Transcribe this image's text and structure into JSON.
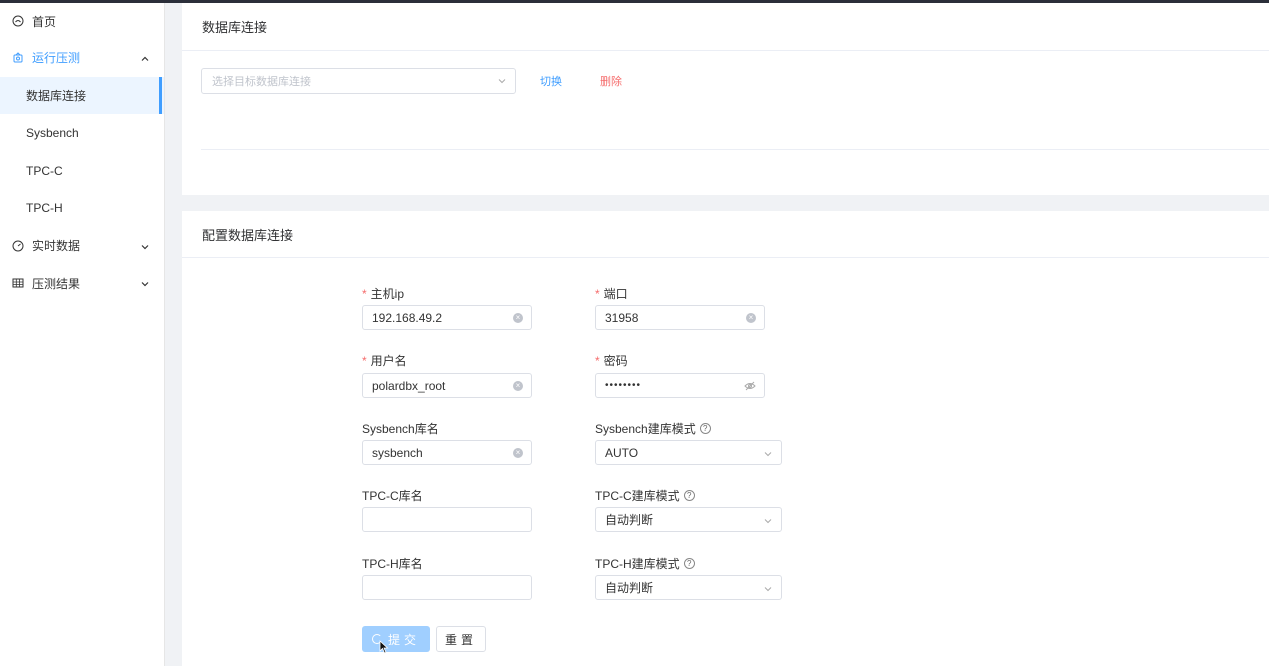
{
  "sidebar": {
    "items": [
      {
        "label": "首页"
      },
      {
        "label": "运行压测"
      },
      {
        "label": "数据库连接"
      },
      {
        "label": "Sysbench"
      },
      {
        "label": "TPC-C"
      },
      {
        "label": "TPC-H"
      },
      {
        "label": "实时数据"
      },
      {
        "label": "压测结果"
      }
    ]
  },
  "db_connection": {
    "title": "数据库连接",
    "select_placeholder": "选择目标数据库连接",
    "switch_label": "切换",
    "delete_label": "删除"
  },
  "config": {
    "title": "配置数据库连接",
    "host_label": "主机ip",
    "host_value": "192.168.49.2",
    "port_label": "端口",
    "port_value": "31958",
    "user_label": "用户名",
    "user_value": "polardbx_root",
    "password_label": "密码",
    "password_value": "••••••••",
    "sysbench_db_label": "Sysbench库名",
    "sysbench_db_value": "sysbench",
    "sysbench_mode_label": "Sysbench建库模式",
    "sysbench_mode_value": "AUTO",
    "tpcc_db_label": "TPC-C库名",
    "tpcc_db_value": "",
    "tpcc_mode_label": "TPC-C建库模式",
    "tpcc_mode_value": "自动判断",
    "tpch_db_label": "TPC-H库名",
    "tpch_db_value": "",
    "tpch_mode_label": "TPC-H建库模式",
    "tpch_mode_value": "自动判断",
    "required_mark": "*",
    "help_mark": "?",
    "submit_label": "提交",
    "reset_label": "重置"
  },
  "colors": {
    "accent": "#409eff",
    "danger": "#f56c6c"
  }
}
